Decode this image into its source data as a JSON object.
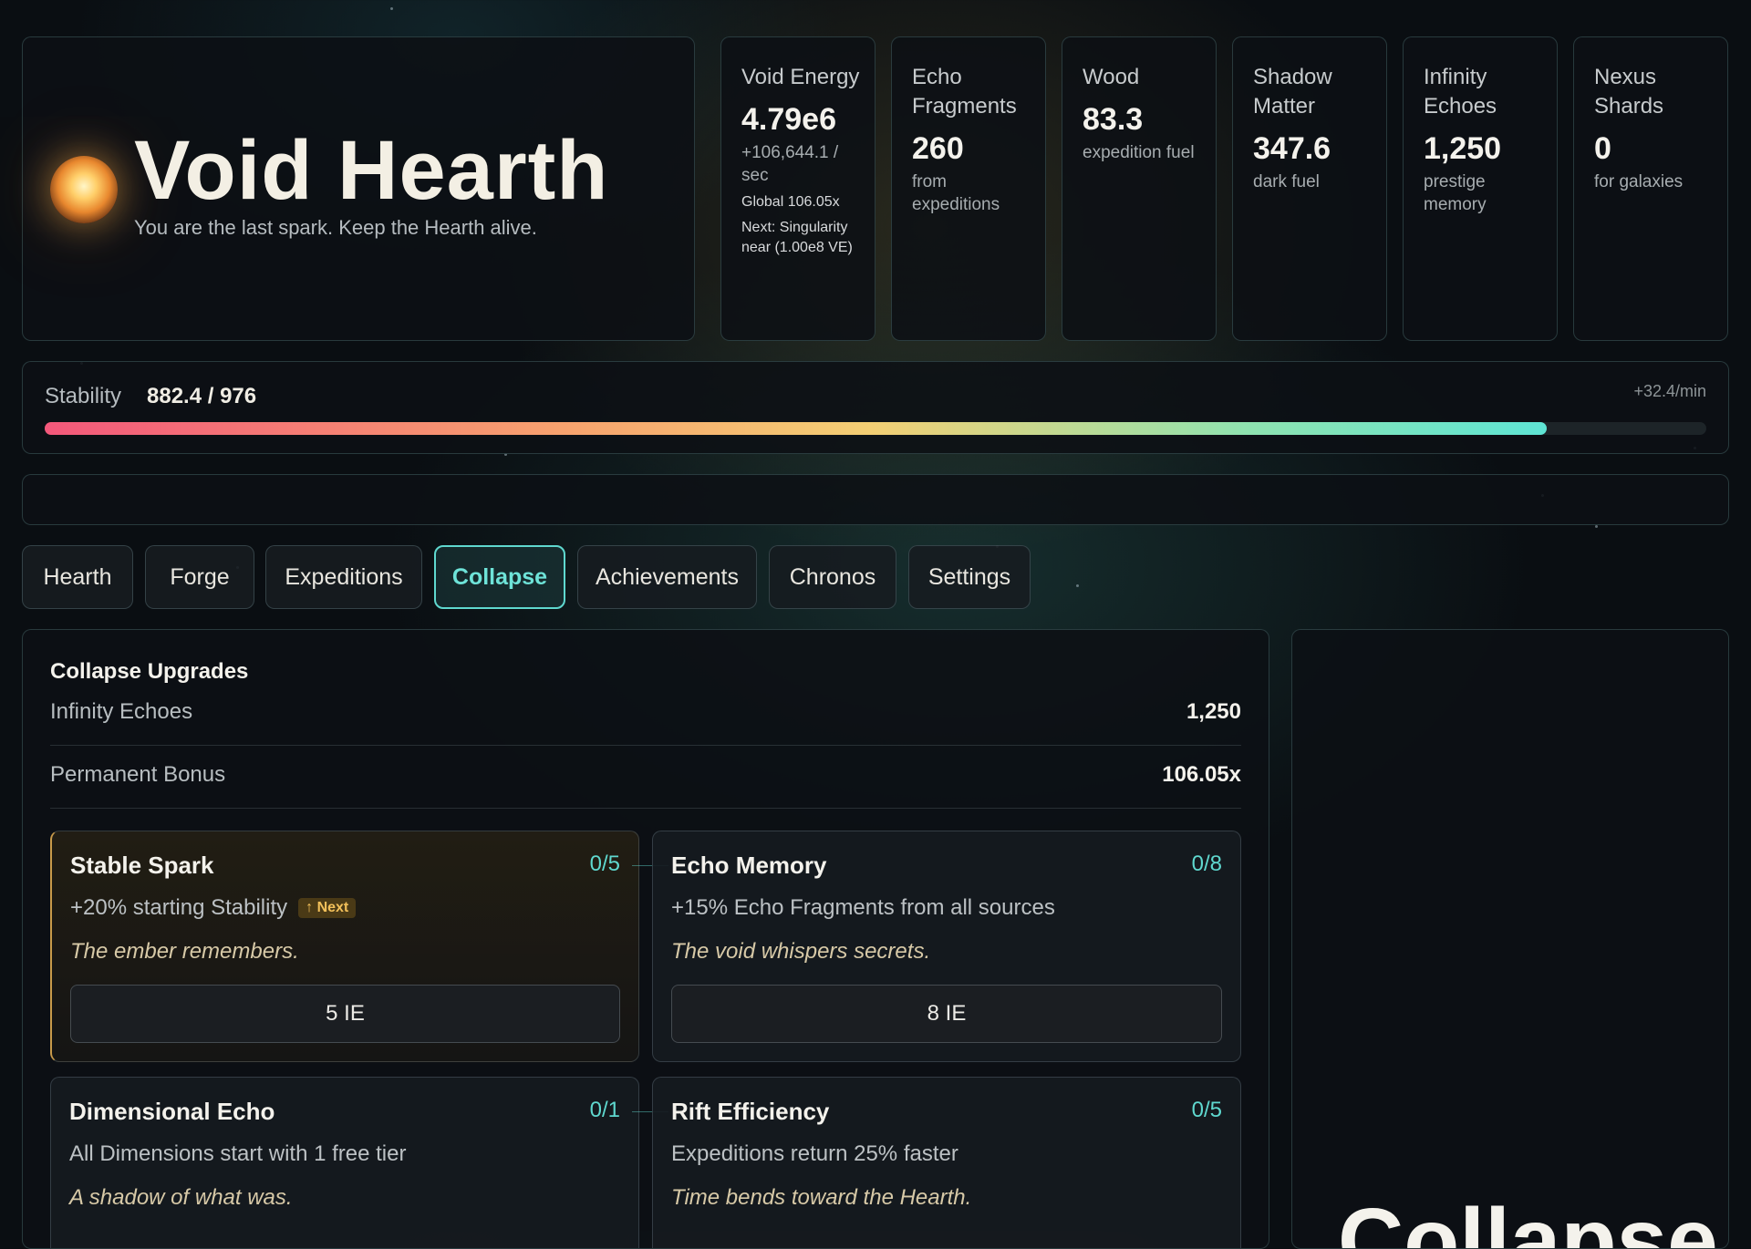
{
  "header": {
    "title": "Void Hearth",
    "tagline": "You are the last spark. Keep the Hearth alive."
  },
  "resources": [
    {
      "label": "Void Energy",
      "value": "4.79e6",
      "sub": "+106,644.1 / sec",
      "extra1": "Global 106.05x",
      "extra2": "Next: Singularity near (1.00e8 VE)"
    },
    {
      "label": "Echo Fragments",
      "value": "260",
      "sub": "from expeditions"
    },
    {
      "label": "Wood",
      "value": "83.3",
      "sub": "expedition fuel"
    },
    {
      "label": "Shadow Matter",
      "value": "347.6",
      "sub": "dark fuel"
    },
    {
      "label": "Infinity Echoes",
      "value": "1,250",
      "sub": "prestige memory"
    },
    {
      "label": "Nexus Shards",
      "value": "0",
      "sub": "for galaxies"
    }
  ],
  "stability": {
    "label": "Stability",
    "value": "882.4 / 976",
    "rate": "+32.4/min",
    "fraction": 0.904
  },
  "tabs": [
    "Hearth",
    "Forge",
    "Expeditions",
    "Collapse",
    "Achievements",
    "Chronos",
    "Settings"
  ],
  "active_tab": "Collapse",
  "collapse": {
    "title": "Collapse Upgrades",
    "stats": [
      {
        "label": "Infinity Echoes",
        "value": "1,250"
      },
      {
        "label": "Permanent Bonus",
        "value": "106.05x"
      }
    ],
    "upgrades": [
      {
        "name": "Stable Spark",
        "level": "0/5",
        "desc": "+20% starting Stability",
        "badge": "↑ Next",
        "flavor": "The ember remembers.",
        "cost": "5 IE"
      },
      {
        "name": "Echo Memory",
        "level": "0/8",
        "desc": "+15% Echo Fragments from all sources",
        "flavor": "The void whispers secrets.",
        "cost": "8 IE"
      },
      {
        "name": "Dimensional Echo",
        "level": "0/1",
        "desc": "All Dimensions start with 1 free tier",
        "flavor": "A shadow of what was."
      },
      {
        "name": "Rift Efficiency",
        "level": "0/5",
        "desc": "Expeditions return 25% faster",
        "flavor": "Time bends toward the Hearth."
      }
    ]
  },
  "side_panel": {
    "heading": "Collapse"
  },
  "colors": {
    "accent": "#5fd8cf",
    "next_badge": "#f2c05a",
    "stability_start": "#f4587b",
    "stability_end": "#5ee4d4"
  },
  "icons": {
    "hearth": "glowing-orb-icon"
  }
}
